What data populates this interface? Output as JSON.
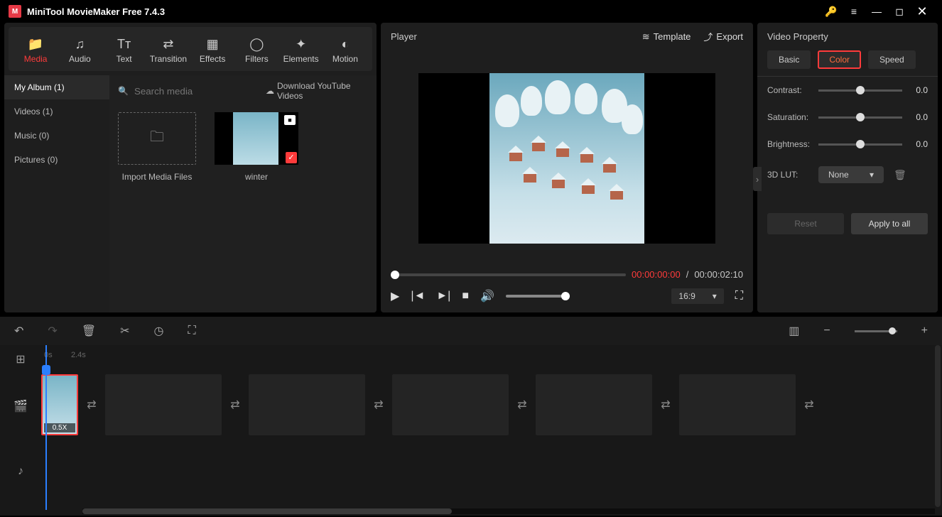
{
  "title": "MiniTool MovieMaker Free 7.4.3",
  "tabs": {
    "media": "Media",
    "audio": "Audio",
    "text": "Text",
    "transition": "Transition",
    "effects": "Effects",
    "filters": "Filters",
    "elements": "Elements",
    "motion": "Motion"
  },
  "sidebar": {
    "album": "My Album (1)",
    "videos": "Videos (1)",
    "music": "Music (0)",
    "pictures": "Pictures (0)"
  },
  "search_placeholder": "Search media",
  "download_label": "Download YouTube Videos",
  "import_label": "Import Media Files",
  "clip_name": "winter",
  "player": {
    "label": "Player",
    "template": "Template",
    "export": "Export",
    "cur": "00:00:00:00",
    "sep": "/",
    "total": "00:00:02:10",
    "ratio": "16:9"
  },
  "prop": {
    "title": "Video Property",
    "basic": "Basic",
    "color": "Color",
    "speed": "Speed",
    "contrast": "Contrast:",
    "saturation": "Saturation:",
    "brightness": "Brightness:",
    "val": "0.0",
    "lut": "3D LUT:",
    "none": "None",
    "reset": "Reset",
    "apply": "Apply to all"
  },
  "ruler": {
    "t0": "0s",
    "t1": "2.4s"
  },
  "clip_badge": "0.5X"
}
